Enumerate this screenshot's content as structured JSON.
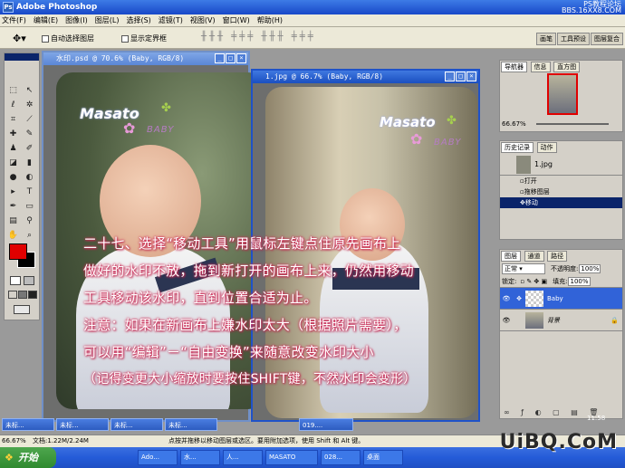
{
  "app": {
    "title": "Adobe Photoshop",
    "brand_line1": "PS教程论坛",
    "brand_line2": "BBS.16XX8.COM"
  },
  "menu": [
    "文件(F)",
    "编辑(E)",
    "图像(I)",
    "图层(L)",
    "选择(S)",
    "滤镜(T)",
    "视图(V)",
    "窗口(W)",
    "帮助(H)"
  ],
  "options": {
    "auto_select": "自动选择图层",
    "show_bounds": "显示定界框"
  },
  "palette_well": [
    "画笔",
    "工具预设",
    "图层复合"
  ],
  "docs": {
    "doc1_title": "水印.psd @ 70.6% (Baby, RGB/8)",
    "doc2_title": "1.jpg @ 66.7% (Baby, RGB/8)"
  },
  "watermark": {
    "brand": "Masato",
    "sub": "BABY"
  },
  "navigator": {
    "tabs": [
      "导航器",
      "信息",
      "直方图"
    ],
    "zoom": "66.67%"
  },
  "history": {
    "tabs": [
      "历史记录",
      "动作"
    ],
    "source": "1.jpg",
    "steps": [
      "打开",
      "拖移图层",
      "移动"
    ]
  },
  "layers": {
    "tabs": [
      "图层",
      "通道",
      "路径"
    ],
    "blend_mode": "正常",
    "opacity_label": "不透明度:",
    "opacity": "100%",
    "lock_label": "锁定:",
    "fill_label": "填充:",
    "fill": "100%",
    "items": [
      {
        "name": "Baby"
      },
      {
        "name": "背景"
      }
    ]
  },
  "tutorial": [
    "二十七、选择“移动工具”用鼠标左键点住原先画布上",
    "做好的水印不放，拖到新打开的画布上来，仍然用移动",
    "工具移动该水印，直到位置合适为止。",
    "注意：如果在新画布上嫌水印太大（根据照片需要），",
    "可以用“编辑”－“自由变换”来随意改变水印大小",
    "（记得变更大小缩放时要按住SHIFT键，不然水印会变形）"
  ],
  "minimized": [
    "未标...",
    "未标...",
    "未标...",
    "未标...",
    "019...."
  ],
  "status": {
    "zoom": "66.67%",
    "doc": "文档:1.22M/2.24M",
    "hint": "点按并拖移以移动图层或选区。要用附加选项，使用 Shift 和 Alt 键。"
  },
  "taskbar": {
    "start": "开始",
    "items": [
      "Ado...",
      "水...",
      "人...",
      "MASATO",
      "028...",
      "桌面"
    ],
    "clock": "11:58"
  },
  "site_watermark": "UiBQ.CoM"
}
